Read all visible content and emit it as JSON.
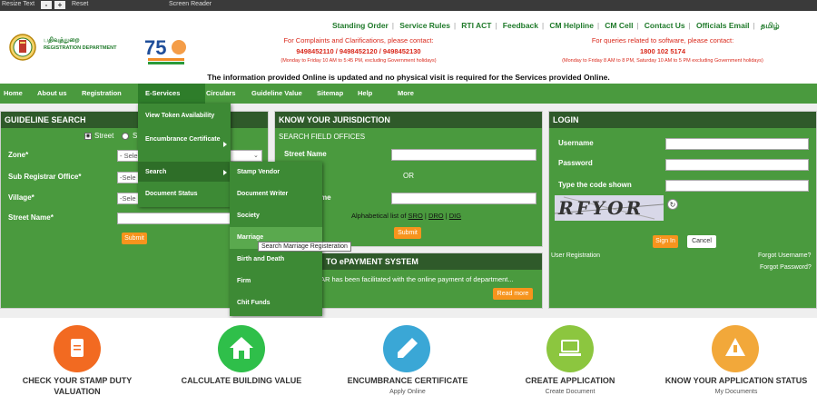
{
  "topbar": {
    "resize_text": "Resize Text",
    "minus": "-",
    "plus": "+",
    "reset": "Reset",
    "screen_reader": "Screen Reader"
  },
  "header": {
    "logo_tamil": "பதிவுத்துறை",
    "logo_english": "REGISTRATION DEPARTMENT",
    "links": [
      "Standing Order",
      "Service Rules",
      "RTI ACT",
      "Feedback",
      "CM Helpline",
      "CM Cell",
      "Contact Us",
      "Officials Email",
      "தமிழ்"
    ],
    "complaints_line1": "For Complaints and Clarifications, please contact:",
    "complaints_phones": "9498452110 / 9498452120 / 9498452130",
    "complaints_hours": "(Monday to Friday 10 AM to 5:45 PM, excluding Government holidays)",
    "software_line1": "For queries related to software, please contact:",
    "software_phone": "1800 102 5174",
    "software_hours": "(Monday to Friday 8 AM to 8 PM, Saturday 10 AM to 5 PM excluding Government holidays)",
    "notice": "The information provided Online is updated and no physical visit is required for the Services provided Online."
  },
  "nav": {
    "items": [
      "Home",
      "About us",
      "Registration",
      "E-Services",
      "Circulars",
      "Guideline Value",
      "Sitemap",
      "Help",
      "More"
    ]
  },
  "eservices_menu": {
    "items": [
      "View Token Availability",
      "Encumbrance Certificate",
      "Search",
      "Document Status"
    ]
  },
  "search_submenu": {
    "items": [
      "Stamp Vendor",
      "Document Writer",
      "Society",
      "Marriage",
      "Birth and Death",
      "Firm",
      "Chit Funds"
    ],
    "tooltip": "Search Marriage Registeration"
  },
  "guideline": {
    "title": "GUIDELINE SEARCH",
    "radio_street": "Street",
    "radio_survey": "S",
    "zone_label": "Zone*",
    "zone_value": "- Sele",
    "sro_label": "Sub Registrar Office*",
    "sro_value": "-Sele",
    "village_label": "Village*",
    "village_value": "-Sele",
    "street_label": "Street Name*",
    "submit": "Submit"
  },
  "jurisdiction": {
    "title": "KNOW YOUR JURISDICTION",
    "subtitle": "SEARCH FIELD OFFICES",
    "street_label": "Street Name",
    "or": "OR",
    "name_partial": "me",
    "alpha_prefix": "Alphabetical list of",
    "alpha_sro": "SRO",
    "alpha_dro": "DRO",
    "alpha_dig": "DIG",
    "submit": "Submit"
  },
  "epayment": {
    "title": "TO ePAYMENT SYSTEM",
    "text": "AR has been facilitated with the online payment of department...",
    "read_more": "Read more"
  },
  "login": {
    "title": "LOGIN",
    "username": "Username",
    "password": "Password",
    "code_label": "Type the code shown",
    "captcha": "RFYOR",
    "sign_in": "Sign In",
    "cancel": "Cancel",
    "user_registration": "User Registration",
    "forgot_username": "Forgot Username?",
    "forgot_password": "Forgot Password?"
  },
  "services": [
    {
      "title": "CHECK YOUR STAMP DUTY",
      "title2": "VALUATION",
      "sub": "",
      "color": "#f26a21"
    },
    {
      "title": "CALCULATE BUILDING VALUE",
      "title2": "",
      "sub": "",
      "color": "#2fbf4a"
    },
    {
      "title": "ENCUMBRANCE CERTIFICATE",
      "title2": "",
      "sub": "Apply Online",
      "color": "#3aa7d6"
    },
    {
      "title": "CREATE APPLICATION",
      "title2": "",
      "sub": "Create Document",
      "color": "#8cc63f"
    },
    {
      "title": "KNOW YOUR APPLICATION STATUS",
      "title2": "",
      "sub": "My Documents",
      "color": "#f2a83a"
    }
  ]
}
